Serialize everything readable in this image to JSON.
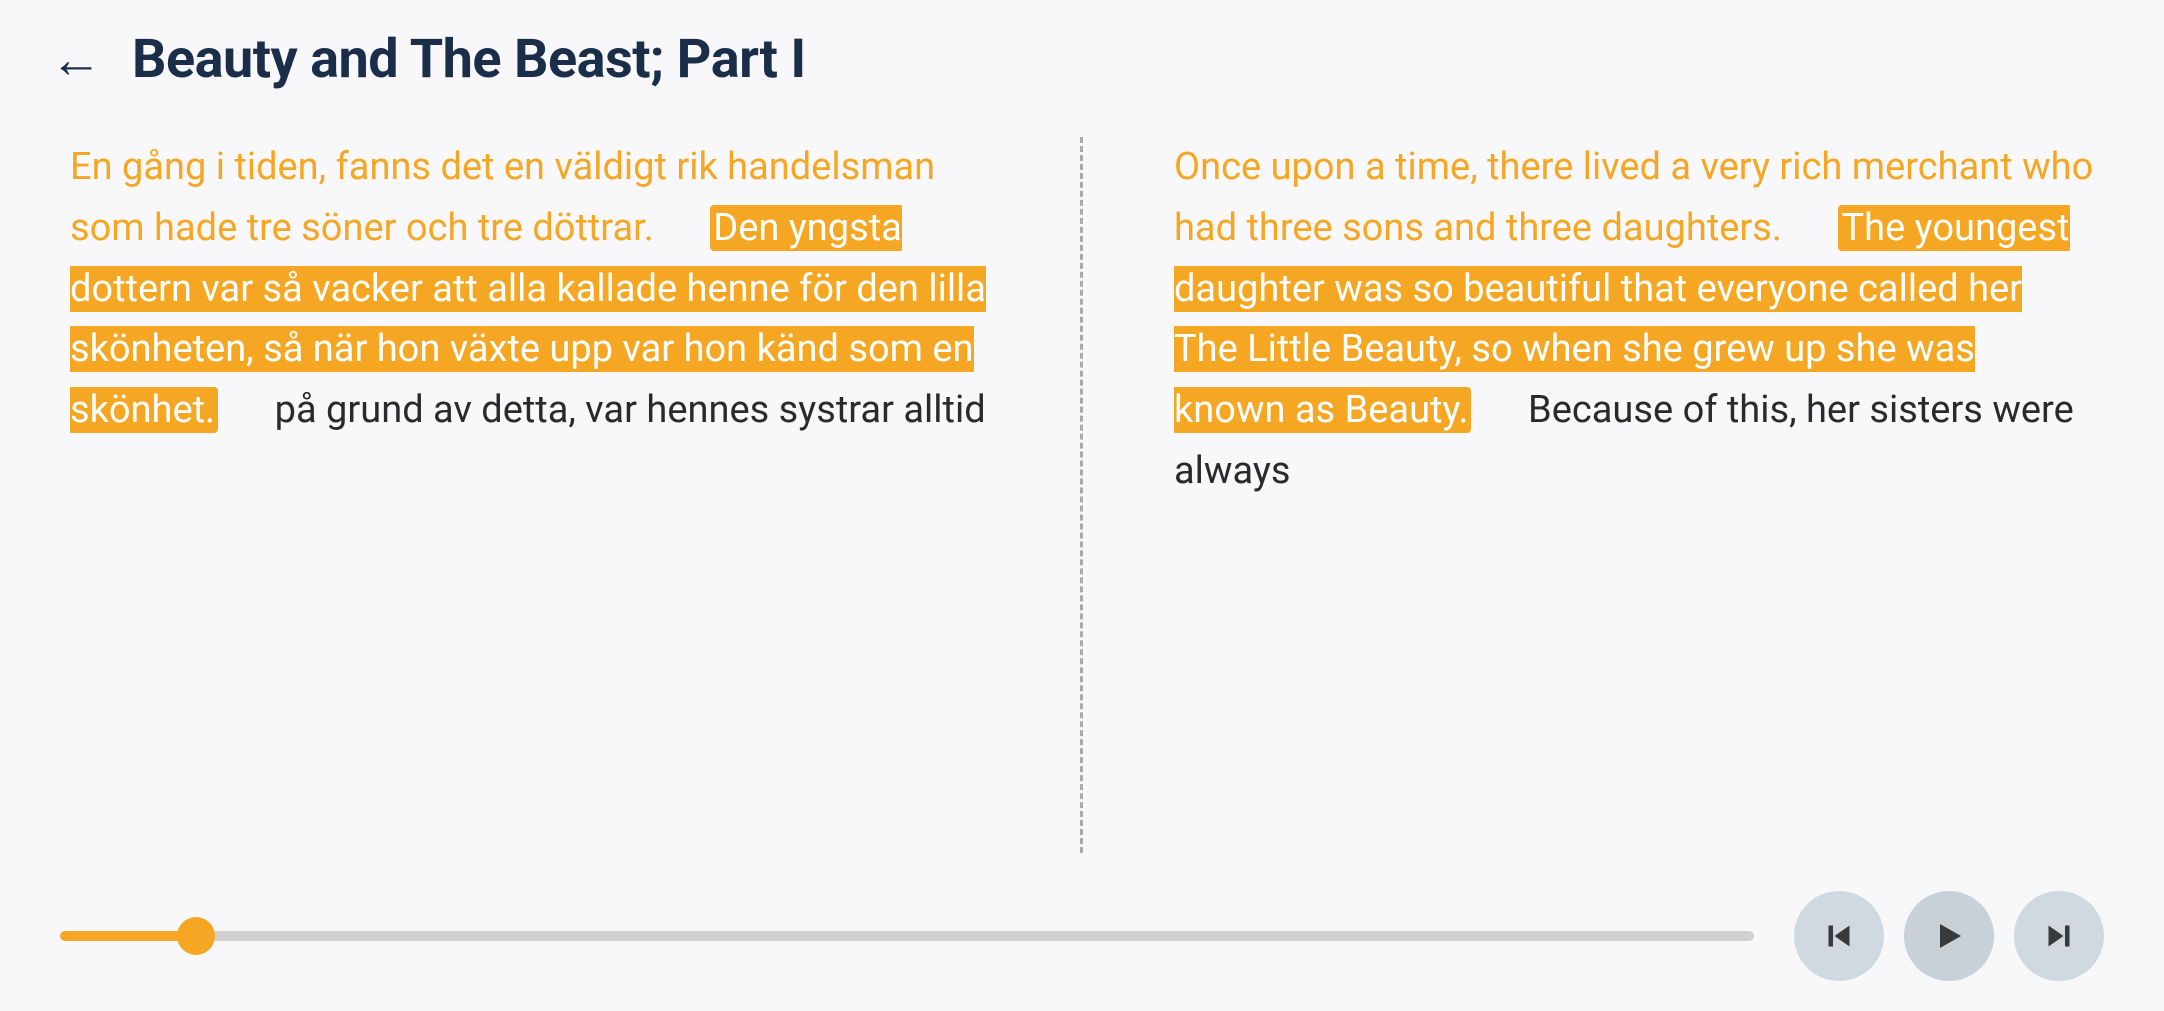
{
  "header": {
    "back_label": "←",
    "title": "Beauty and The Beast; Part I"
  },
  "left_column": {
    "text_normal_1": "En gång i tiden, fanns det en väldigt rik handelsman som hade tre söner och tre döttrar.",
    "text_highlight_1": "Den yngsta dottern var så vacker att alla kallade henne för den lilla skönheten, så när hon växte upp var hon känd som en skönhet.",
    "text_normal_2": "på grund av detta, var hennes systrar alltid"
  },
  "right_column": {
    "text_normal_1": "Once upon a time, there lived a very rich merchant who had three sons and three daughters.",
    "text_highlight_1": "The youngest daughter was so beautiful that everyone called her The Little Beauty, so when she grew up she was known as Beauty.",
    "text_normal_2": "Because of this, her sisters were always"
  },
  "controls": {
    "prev_label": "⏮",
    "play_label": "▶",
    "next_label": "⏭"
  },
  "progress": {
    "value": 8
  }
}
